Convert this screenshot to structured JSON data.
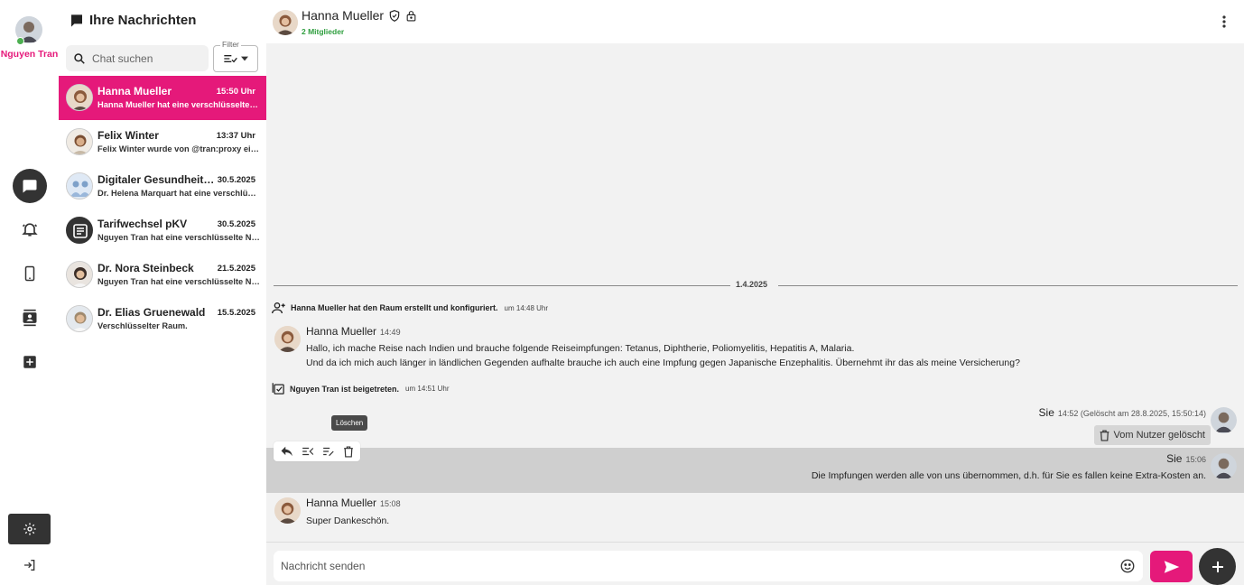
{
  "me": {
    "name": "Nguyen Tran"
  },
  "sidebar_rail": {
    "nav": [
      {
        "icon": "chat-bubble-icon"
      },
      {
        "icon": "bell-icon"
      },
      {
        "icon": "phone-icon"
      },
      {
        "icon": "contacts-icon"
      },
      {
        "icon": "add-box-icon"
      }
    ],
    "bottom": [
      {
        "icon": "gear-icon"
      },
      {
        "icon": "logout-icon"
      }
    ]
  },
  "chat_list": {
    "title": "Ihre Nachrichten",
    "search_placeholder": "Chat suchen",
    "filter_label": "Filter",
    "chats": [
      {
        "name": "Hanna Mueller",
        "time": "15:50 Uhr",
        "preview": "Hanna Mueller hat eine verschlüsselte Nachricht gesendet."
      },
      {
        "name": "Felix Winter",
        "time": "13:37 Uhr",
        "preview": "Felix Winter wurde von @tran:proxy eingeladen."
      },
      {
        "name": "Digitaler Gesundheitsclub",
        "time": "30.5.2025",
        "preview": "Dr. Helena Marquart hat eine verschlüsselte Nachricht gesendet."
      },
      {
        "name": "Tarifwechsel pKV",
        "time": "30.5.2025",
        "preview": "Nguyen Tran hat eine verschlüsselte Nachricht gesendet."
      },
      {
        "name": "Dr. Nora Steinbeck",
        "time": "21.5.2025",
        "preview": "Nguyen Tran hat eine verschlüsselte Nachricht gesendet."
      },
      {
        "name": "Dr. Elias Gruenewald",
        "time": "15.5.2025",
        "preview": "Verschlüsselter Raum."
      }
    ]
  },
  "header": {
    "name": "Hanna Mueller",
    "members": "2 Mitglieder"
  },
  "messages": {
    "date": "1.4.2025",
    "sys1": {
      "text": "Hanna Mueller hat den Raum erstellt und konfiguriert.",
      "time": "um 14:48 Uhr"
    },
    "m1": {
      "sender": "Hanna Mueller",
      "time": "14:49",
      "line1": "Hallo, ich mache Reise nach Indien und brauche folgende Reiseimpfungen: Tetanus, Diphtherie, Poliomyelitis, Hepatitis A, Malaria.",
      "line2": "Und da ich mich auch länger in ländlichen Gegenden aufhalte brauche ich auch eine Impfung gegen Japanische Enzephalitis. Übernehmt ihr das als meine Versicherung?"
    },
    "sys2": {
      "text": "Nguyen Tran ist beigetreten.",
      "time": "um 14:51 Uhr"
    },
    "m2": {
      "sender": "Sie",
      "time": "14:52 (Gelöscht am 28.8.2025, 15:50:14)",
      "deleted_label": "Vom Nutzer gelöscht"
    },
    "tooltip": "Löschen",
    "m3": {
      "sender": "Sie",
      "time": "15:06",
      "text": "Die Impfungen werden alle von uns übernommen, d.h. für Sie es fallen keine Extra-Kosten an."
    },
    "m4": {
      "sender": "Hanna Mueller",
      "time": "15:08",
      "text": "Super Dankeschön."
    }
  },
  "composer": {
    "placeholder": "Nachricht senden"
  },
  "colors": {
    "accent": "#e5197a",
    "dark": "#333333",
    "online": "#4caf50",
    "members": "#2e9e3e"
  }
}
